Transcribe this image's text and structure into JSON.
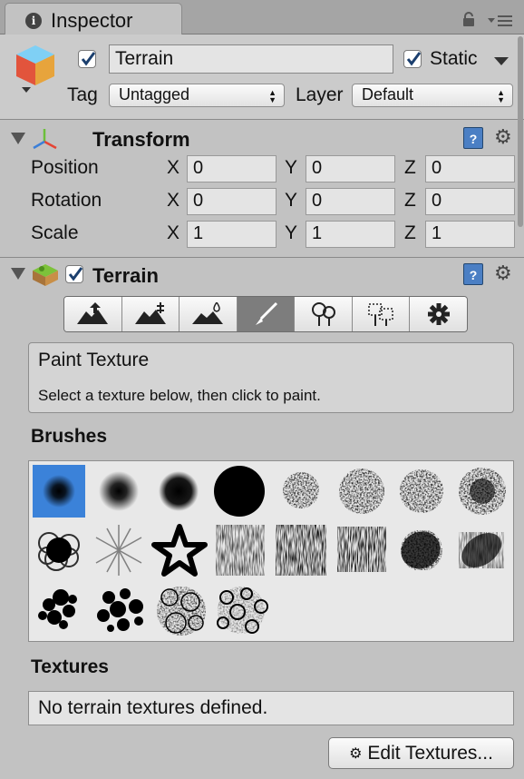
{
  "tab": {
    "title": "Inspector",
    "info_glyph": "i"
  },
  "header": {
    "object_name": "Terrain",
    "active_checked": true,
    "static_label": "Static",
    "static_checked": true,
    "tag_label": "Tag",
    "tag_value": "Untagged",
    "layer_label": "Layer",
    "layer_value": "Default"
  },
  "transform": {
    "title": "Transform",
    "axes": {
      "x": "X",
      "y": "Y",
      "z": "Z"
    },
    "rows": [
      {
        "label": "Position",
        "x": "0",
        "y": "0",
        "z": "0"
      },
      {
        "label": "Rotation",
        "x": "0",
        "y": "0",
        "z": "0"
      },
      {
        "label": "Scale",
        "x": "1",
        "y": "1",
        "z": "1"
      }
    ]
  },
  "terrain": {
    "title": "Terrain",
    "enabled": true,
    "tools": [
      {
        "name": "raise-lower-terrain-icon",
        "active": false
      },
      {
        "name": "paint-height-icon",
        "active": false
      },
      {
        "name": "smooth-height-icon",
        "active": false
      },
      {
        "name": "paint-texture-icon",
        "active": true
      },
      {
        "name": "place-trees-icon",
        "active": false
      },
      {
        "name": "paint-details-icon",
        "active": false
      },
      {
        "name": "terrain-settings-icon",
        "active": false
      }
    ],
    "tool_title": "Paint Texture",
    "tool_hint": "Select a texture below, then click to paint.",
    "brushes_label": "Brushes",
    "brush_count": 20,
    "selected_brush": 0,
    "textures_label": "Textures",
    "textures_empty": "No terrain textures defined.",
    "edit_textures_label": "Edit Textures..."
  },
  "colors": {
    "accent": "#3b82d9",
    "panel": "#c2c2c2"
  }
}
